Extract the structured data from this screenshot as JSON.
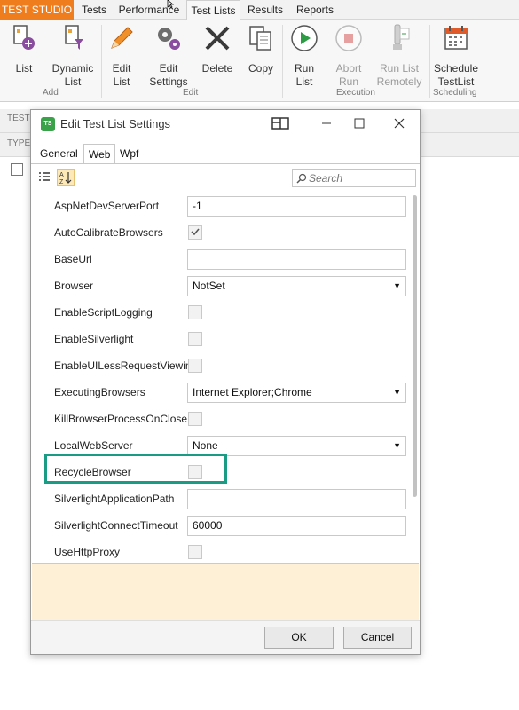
{
  "ribbon_tabs": {
    "app": "TEST STUDIO",
    "tests": "Tests",
    "performance": "Performance",
    "test_lists": "Test Lists",
    "results": "Results",
    "reports": "Reports"
  },
  "ribbon": {
    "add": {
      "label": "Add",
      "list": "List",
      "dynamic_list": "Dynamic\nList"
    },
    "edit": {
      "label": "Edit",
      "edit_list": "Edit\nList",
      "edit_settings": "Edit\nSettings",
      "delete": "Delete",
      "copy": "Copy"
    },
    "execution": {
      "label": "Execution",
      "run_list": "Run\nList",
      "abort_run": "Abort\nRun",
      "run_list_remotely": "Run List\nRemotely"
    },
    "scheduling": {
      "label": "Scheduling",
      "schedule_testlist": "Schedule\nTestList"
    }
  },
  "background": {
    "row1": "TEST",
    "row2": "TYPE"
  },
  "dialog": {
    "title": "Edit Test List Settings",
    "tabs": [
      "General",
      "Web",
      "Wpf"
    ],
    "active_tab": "Web",
    "search_placeholder": "Search",
    "properties": [
      {
        "name": "AspNetDevServerPort",
        "type": "text",
        "value": "-1"
      },
      {
        "name": "AutoCalibrateBrowsers",
        "type": "check",
        "checked": true
      },
      {
        "name": "BaseUrl",
        "type": "text",
        "value": ""
      },
      {
        "name": "Browser",
        "type": "select",
        "value": "NotSet"
      },
      {
        "name": "EnableScriptLogging",
        "type": "check",
        "checked": false
      },
      {
        "name": "EnableSilverlight",
        "type": "check",
        "checked": false
      },
      {
        "name": "EnableUILessRequestViewing",
        "type": "check",
        "checked": false
      },
      {
        "name": "ExecutingBrowsers",
        "type": "select",
        "value": "Internet Explorer;Chrome"
      },
      {
        "name": "KillBrowserProcessOnClose",
        "type": "check",
        "checked": false
      },
      {
        "name": "LocalWebServer",
        "type": "select",
        "value": "None"
      },
      {
        "name": "RecycleBrowser",
        "type": "check",
        "checked": false
      },
      {
        "name": "SilverlightApplicationPath",
        "type": "text",
        "value": ""
      },
      {
        "name": "SilverlightConnectTimeout",
        "type": "text",
        "value": "60000"
      },
      {
        "name": "UseHttpProxy",
        "type": "check",
        "checked": false
      }
    ],
    "ok": "OK",
    "cancel": "Cancel"
  },
  "colors": {
    "app_tab": "#f07d1d",
    "highlight": "#1a9c84",
    "description_bg": "#fdf0d6"
  }
}
